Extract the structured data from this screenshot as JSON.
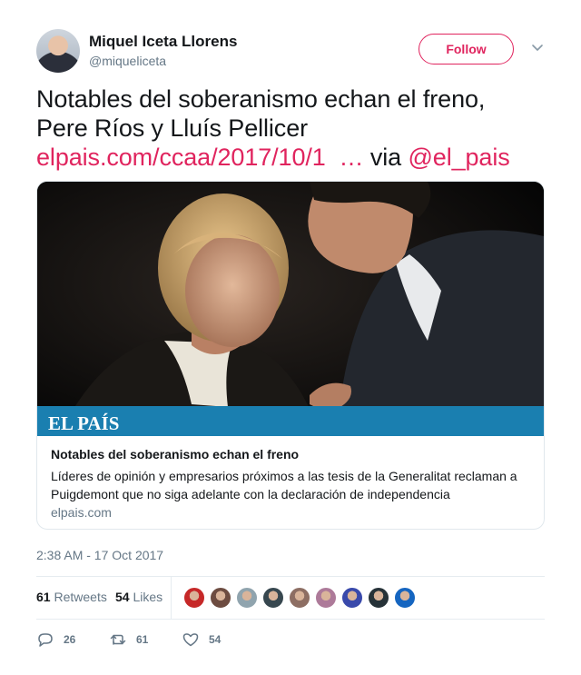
{
  "author": {
    "name": "Miquel Iceta Llorens",
    "handle": "@miqueliceta",
    "follow_label": "Follow"
  },
  "tweet": {
    "line1": "Notables del soberanismo echan el freno,",
    "line2": "Pere Ríos y Lluís Pellicer",
    "link_text": "elpais.com/ccaa/2017/10/1",
    "ellipsis": "…",
    "via_text": "via",
    "mention": "@el_pais"
  },
  "card": {
    "brand": "EL PAÍS",
    "title": "Notables del soberanismo echan el freno",
    "description": "Líderes de opinión y empresarios próximos a las tesis de la Generalitat reclaman a Puigdemont que no siga adelante con la declaración de independencia",
    "domain": "elpais.com"
  },
  "timestamp": "2:38 AM - 17 Oct 2017",
  "stats": {
    "retweets_count": "61",
    "retweets_label": "Retweets",
    "likes_count": "54",
    "likes_label": "Likes"
  },
  "liker_avatars": [
    "#c62828",
    "#6d4c41",
    "#90a4ae",
    "#37474f",
    "#8d6e63",
    "#ad7a99",
    "#3949ab",
    "#263238",
    "#1565c0"
  ],
  "actions": {
    "reply_count": "26",
    "retweet_count": "61",
    "like_count": "54"
  },
  "colors": {
    "accent": "#e0245e",
    "muted": "#657786",
    "brand_bar": "#1a7fb0"
  },
  "icons": [
    "caret-down-icon",
    "reply-icon",
    "retweet-icon",
    "heart-icon"
  ]
}
